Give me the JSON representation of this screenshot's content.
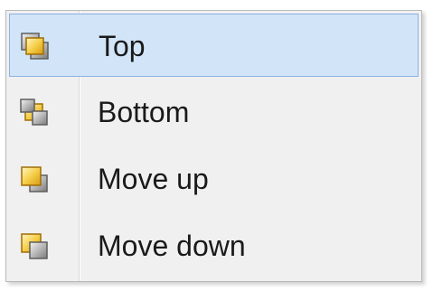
{
  "menu": {
    "items": [
      {
        "label": "Top",
        "icon": "bring-to-front-icon",
        "selected": true
      },
      {
        "label": "Bottom",
        "icon": "send-to-back-icon",
        "selected": false
      },
      {
        "label": "Move up",
        "icon": "bring-forward-icon",
        "selected": false
      },
      {
        "label": "Move down",
        "icon": "send-backward-icon",
        "selected": false
      }
    ]
  },
  "colors": {
    "highlight_bg": "#d2e5f8",
    "highlight_border": "#8ab2df",
    "menu_bg": "#f0f0f0"
  }
}
